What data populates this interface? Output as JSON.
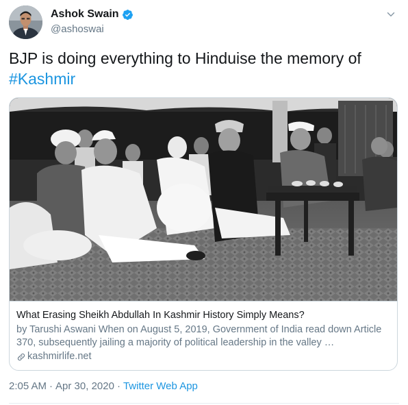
{
  "author": {
    "name": "Ashok Swain",
    "handle": "@ashoswai"
  },
  "tweet": {
    "text_plain": "BJP is doing everything to Hinduise the memory of",
    "hashtag": "#Kashmir"
  },
  "card": {
    "title": "What Erasing Sheikh Abdullah In Kashmir History Simply Means?",
    "description": "by Tarushi Aswani When on August 5, 2019, Government of India read down Article 370, subsequently jailing a majority of political leadership in the valley …",
    "domain": "kashmirlife.net"
  },
  "meta": {
    "time": "2:05 AM",
    "separator1": "·",
    "date": "Apr 30, 2020",
    "separator2": "·",
    "source": "Twitter Web App"
  },
  "colors": {
    "link": "#1b95e0",
    "secondary_text": "#657786",
    "primary_text": "#14171a",
    "border": "#ccd6dd"
  }
}
